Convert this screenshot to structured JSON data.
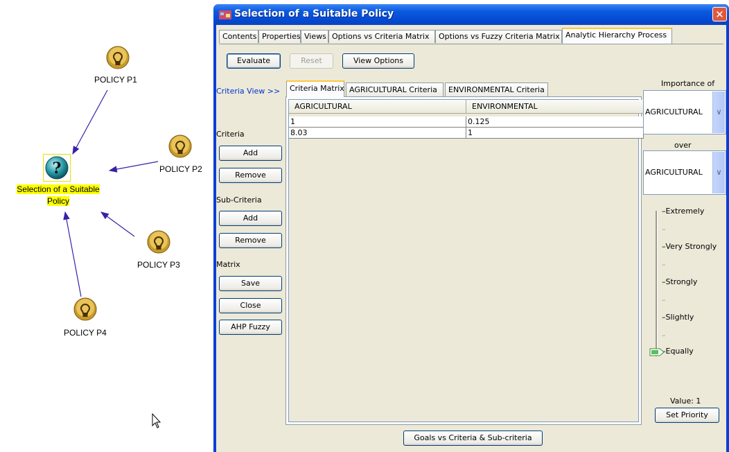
{
  "diagram": {
    "goal_label": "Selection of  a Suitable Policy",
    "policies": [
      "POLICY P1",
      "POLICY P2",
      "POLICY P3",
      "POLICY P4"
    ]
  },
  "window": {
    "title": "Selection of  a Suitable Policy",
    "close_glyph": "✕",
    "tabs": [
      "Contents",
      "Properties",
      "Views",
      "Options vs Criteria Matrix",
      "Options vs Fuzzy Criteria Matrix",
      "Analytic Hierarchy Process"
    ],
    "active_tab": "Analytic Hierarchy Process"
  },
  "toolbar": {
    "evaluate": "Evaluate",
    "reset": "Reset",
    "view_options": "View Options"
  },
  "left_panel": {
    "criteria_view_link": "Criteria View >>",
    "criteria_label": "Criteria",
    "criteria_add": "Add",
    "criteria_remove": "Remove",
    "subcriteria_label": "Sub-Criteria",
    "subcriteria_add": "Add",
    "subcriteria_remove": "Remove",
    "matrix_label": "Matrix",
    "save": "Save",
    "close": "Close",
    "ahp_fuzzy": "AHP Fuzzy"
  },
  "matrix": {
    "tabs": [
      "Criteria Matrix",
      "AGRICULTURAL Criteria",
      "ENVIRONMENTAL Criteria"
    ],
    "active_tab": "Criteria Matrix",
    "columns": [
      "AGRICULTURAL",
      "ENVIRONMENTAL"
    ],
    "rows": [
      [
        "1",
        "0.125"
      ],
      [
        "8.03",
        "1"
      ]
    ]
  },
  "importance": {
    "importance_of_label": "Importance of",
    "first_value": "AGRICULTURAL",
    "over_label": "over",
    "second_value": "AGRICULTURAL",
    "scale": [
      "Extremely",
      "Very Strongly",
      "Strongly",
      "Slightly",
      "Equally"
    ],
    "minor_tick": "–",
    "selected": "Equally",
    "value_text": "Value: 1",
    "set_priority": "Set Priority"
  },
  "bottom": {
    "goals_button": "Goals vs Criteria & Sub-criteria"
  },
  "colors": {
    "titlebar": "#0a5ae0",
    "highlight": "#ffff00",
    "arrow": "#3a1fa8",
    "active_tab_accent": "#ffc83c"
  }
}
